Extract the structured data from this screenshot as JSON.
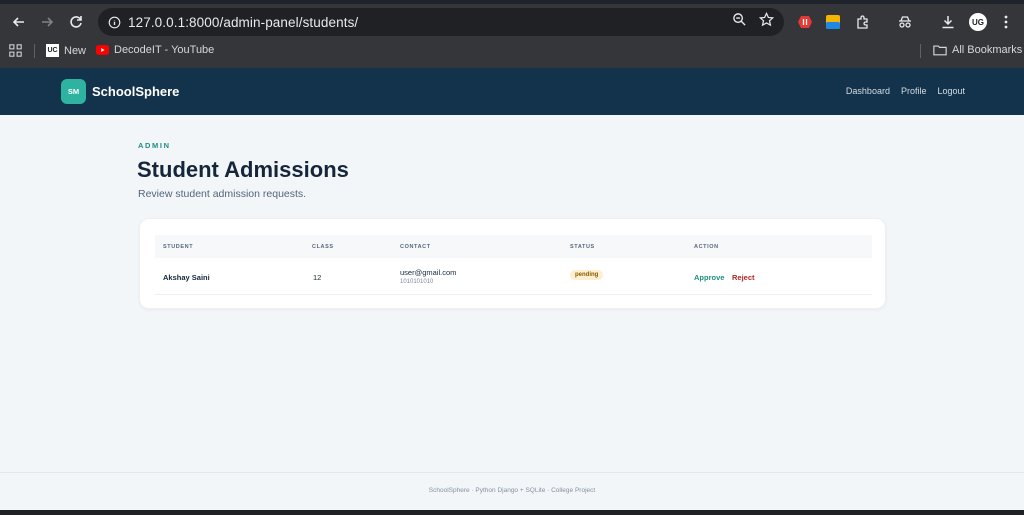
{
  "browser": {
    "url": "127.0.0.1:8000/admin-panel/students/",
    "bookmarks": [
      {
        "label": "New",
        "icon": "uc-icon"
      },
      {
        "label": "DecodeIT - YouTube",
        "icon": "youtube-icon"
      }
    ],
    "all_bookmarks_label": "All Bookmarks",
    "avatar_initials": "UG"
  },
  "app": {
    "logo_initials": "SM",
    "name": "SchoolSphere",
    "nav": [
      "Dashboard",
      "Profile",
      "Logout"
    ]
  },
  "page": {
    "eyebrow": "ADMIN",
    "title": "Student Admissions",
    "subtitle": "Review student admission requests."
  },
  "table": {
    "columns": [
      "STUDENT",
      "CLASS",
      "CONTACT",
      "STATUS",
      "ACTION"
    ],
    "rows": [
      {
        "student": "Akshay Saini",
        "class": "12",
        "email": "user@gmail.com",
        "phone": "1010101010",
        "status": "pending",
        "actions": [
          "Approve",
          "Reject"
        ]
      }
    ]
  },
  "footer": "SchoolSphere · Python Django + SQLite · College Project",
  "colors": {
    "header_bg": "#13324b",
    "accent": "#2db3a0",
    "approve": "#1f8f7e",
    "reject": "#b32525",
    "pending_bg": "#fdefcf"
  }
}
